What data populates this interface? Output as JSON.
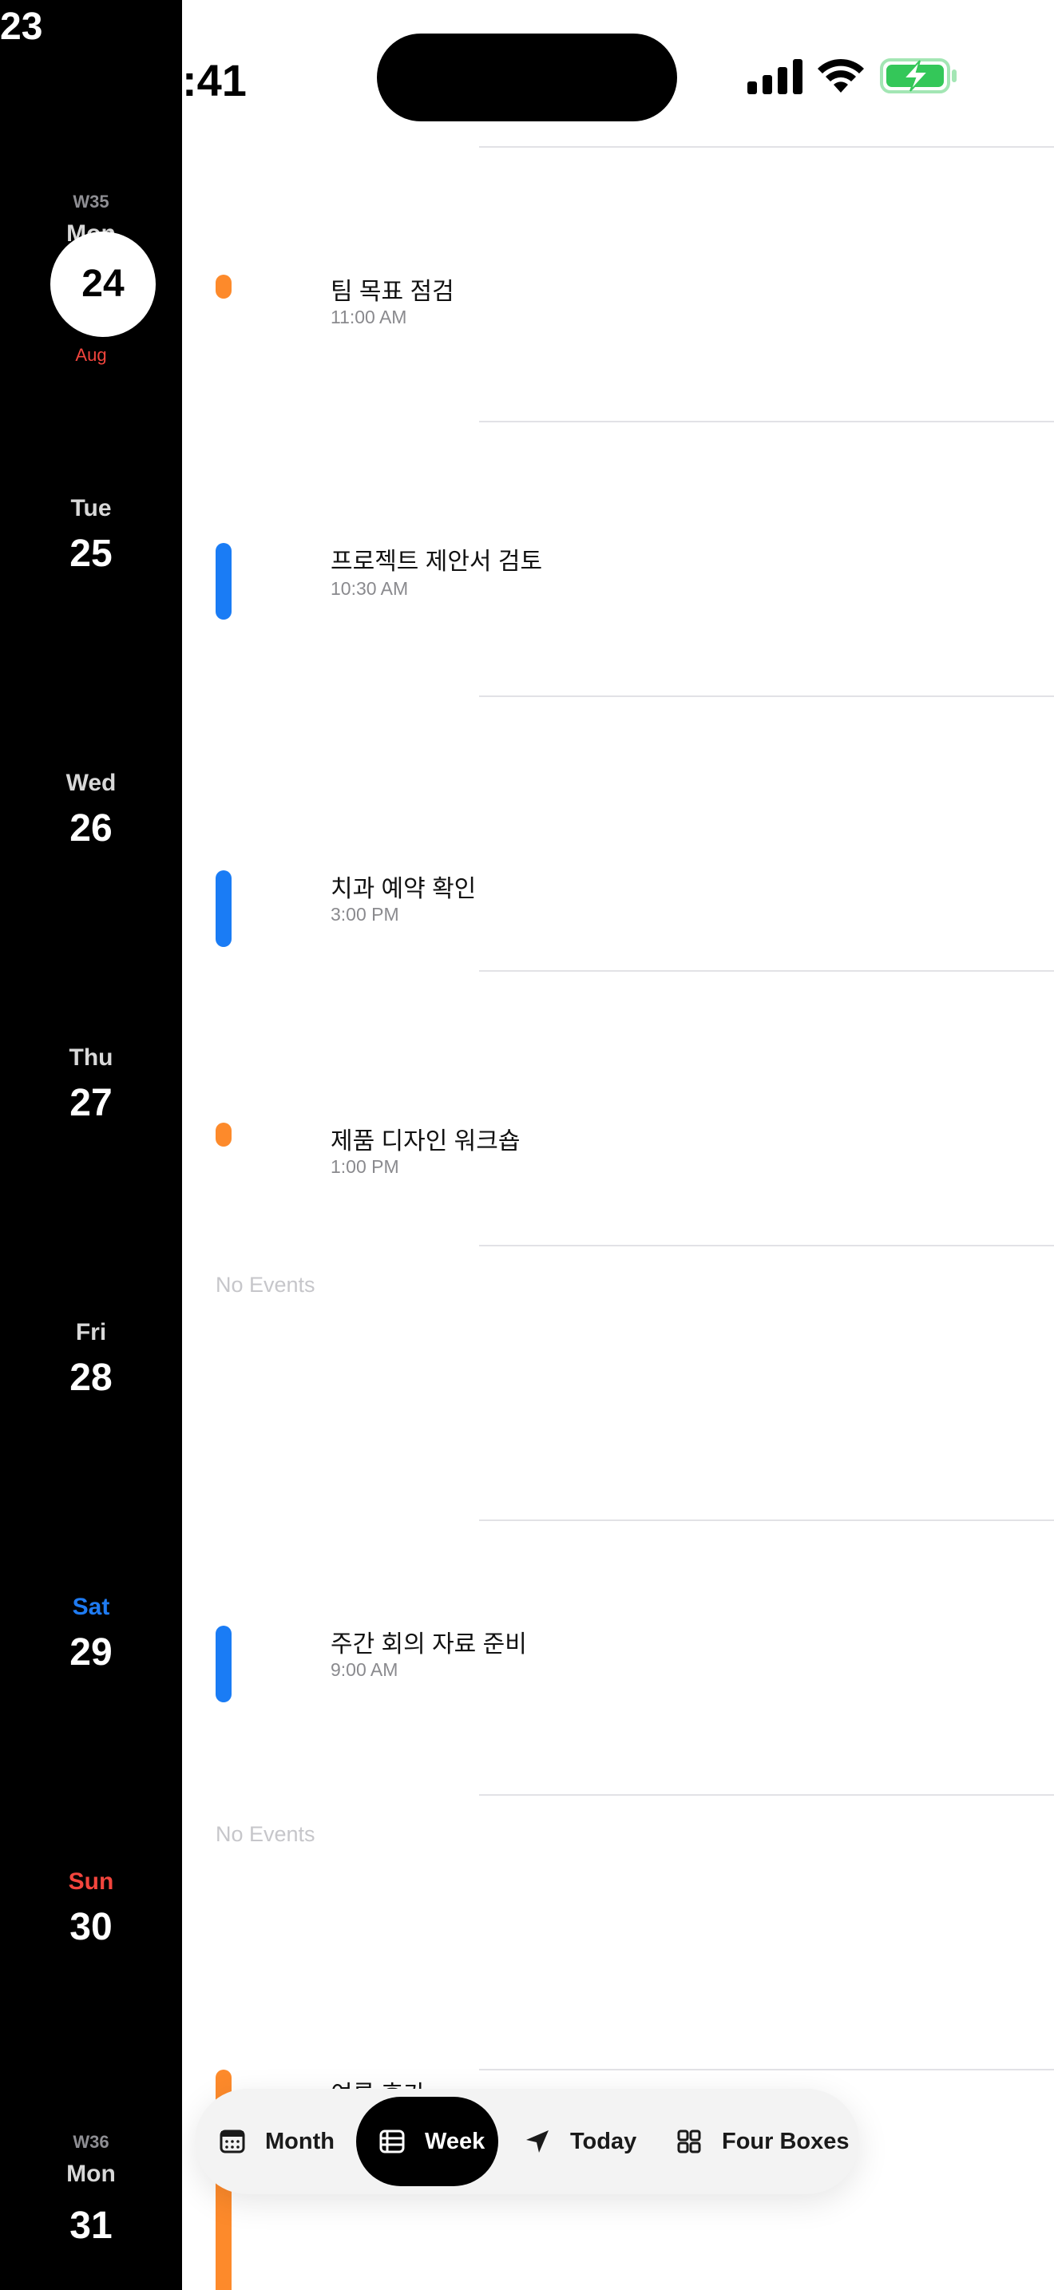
{
  "status_bar": {
    "time": ":41"
  },
  "rail": {
    "top_partial_day": "23",
    "days": [
      {
        "week": "W35",
        "dow": "Mon",
        "num": "24",
        "month": "Aug",
        "today": true
      },
      {
        "week": "",
        "dow": "Tue",
        "num": "25",
        "month": ""
      },
      {
        "week": "",
        "dow": "Wed",
        "num": "26",
        "month": ""
      },
      {
        "week": "",
        "dow": "Thu",
        "num": "27",
        "month": ""
      },
      {
        "week": "",
        "dow": "Fri",
        "num": "28",
        "month": ""
      },
      {
        "week": "",
        "dow": "Sat",
        "num": "29",
        "month": ""
      },
      {
        "week": "",
        "dow": "Sun",
        "num": "30",
        "month": ""
      },
      {
        "week": "W36",
        "dow": "Mon",
        "num": "31",
        "month": ""
      }
    ]
  },
  "events": [
    {
      "title": "팀 목표 점검",
      "time": "11:00 AM",
      "marker": "dot"
    },
    {
      "title": "프로젝트 제안서 검토",
      "time": "10:30 AM",
      "marker": "bar"
    },
    {
      "title": "치과 예약 확인",
      "time": "3:00 PM",
      "marker": "bar"
    },
    {
      "title": "제품 디자인 워크숍",
      "time": "1:00 PM",
      "marker": "dot"
    },
    {
      "title": "주간 회의 자료 준비",
      "time": "9:00 AM",
      "marker": "bar"
    },
    {
      "title": "여름 휴가",
      "time": "",
      "marker": "strip"
    }
  ],
  "no_events_label": "No Events",
  "tabs": {
    "month": "Month",
    "week": "Week",
    "today": "Today",
    "four_boxes": "Four Boxes",
    "active": "week"
  },
  "colors": {
    "rail_bg": "#000000",
    "orange": "#fd8a2b",
    "blue": "#1a7cf5",
    "sat": "#1f7bf2",
    "sun": "#f2453d",
    "battery_green": "#34c759"
  }
}
